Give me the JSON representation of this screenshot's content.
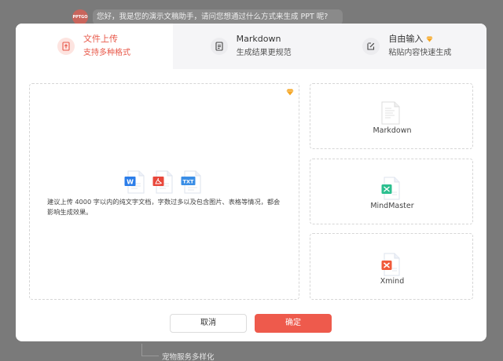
{
  "background": {
    "avatar_text": "PPTGO",
    "chat_message": "您好，我是您的演示文稿助手，请问您想通过什么方式来生成 PPT 呢?",
    "bottom_text": "宠物服务多样化"
  },
  "tabs": [
    {
      "title": "文件上传",
      "subtitle": "支持多种格式",
      "icon": "upload-file-icon",
      "active": true
    },
    {
      "title": "Markdown",
      "subtitle": "生成结果更规范",
      "icon": "markdown-doc-icon",
      "active": false
    },
    {
      "title": "自由输入",
      "subtitle": "粘贴内容快速生成",
      "icon": "edit-icon",
      "active": false,
      "vip": true
    }
  ],
  "upload": {
    "file_types": [
      "W",
      "PDF",
      "TXT"
    ],
    "hint": "建议上传 4000 字以内的纯文字文档，字数过多以及包含图片、表格等情况，都会影响生成效果。"
  },
  "options": [
    {
      "label": "Markdown",
      "icon": "markdown-file-icon"
    },
    {
      "label": "MindMaster",
      "icon": "mindmaster-file-icon"
    },
    {
      "label": "Xmind",
      "icon": "xmind-file-icon"
    }
  ],
  "buttons": {
    "cancel": "取消",
    "confirm": "确定"
  },
  "colors": {
    "accent": "#ee5a4c",
    "vip": "#f5a623",
    "word": "#2b7de9",
    "pdf": "#e8473b",
    "txt": "#3a8ee6",
    "mindmaster": "#2bbf8f",
    "xmind": "#f05a3a"
  }
}
